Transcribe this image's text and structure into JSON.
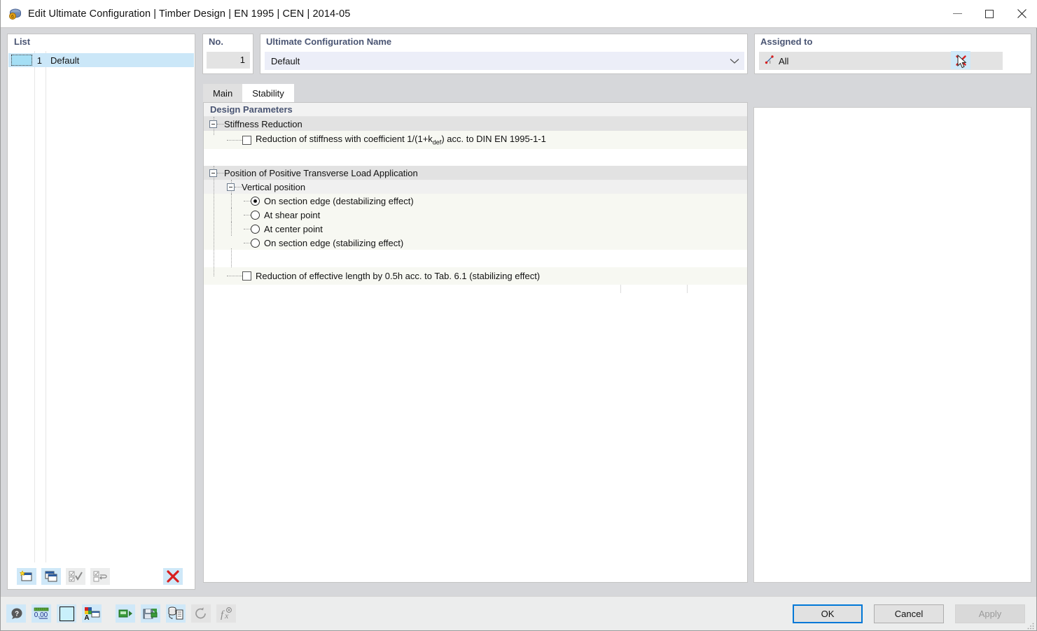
{
  "window": {
    "title": "Edit Ultimate Configuration | Timber Design | EN 1995 | CEN | 2014-05",
    "icon": "app-icon",
    "controls": {
      "minimize": "minimize-icon",
      "maximize": "maximize-icon",
      "close": "close-icon"
    }
  },
  "list_panel": {
    "header": "List",
    "rows": [
      {
        "no": "1",
        "name": "Default",
        "selected": true
      }
    ],
    "toolbar": [
      {
        "name": "new-configuration-button",
        "icon": "new-window-star-icon",
        "enabled": true
      },
      {
        "name": "copy-configuration-button",
        "icon": "copy-window-icon",
        "enabled": true
      },
      {
        "name": "select-all-button",
        "icon": "check-all-icon",
        "enabled": false
      },
      {
        "name": "invert-selection-button",
        "icon": "invert-selection-icon",
        "enabled": false
      },
      {
        "name": "delete-configuration-button",
        "icon": "red-x-icon",
        "enabled": true
      }
    ]
  },
  "no_field": {
    "label": "No.",
    "value": "1"
  },
  "name_field": {
    "label": "Ultimate Configuration Name",
    "value": "Default",
    "dropdown_icon": "chevron-down-icon"
  },
  "assigned_to": {
    "label": "Assigned to",
    "value": "All",
    "value_icon": "member-line-icon",
    "clear_button": "red-x-icon"
  },
  "tabs": [
    {
      "label": "Main",
      "active": false
    },
    {
      "label": "Stability",
      "active": true
    }
  ],
  "design_parameters": {
    "header": "Design Parameters",
    "groups": [
      {
        "title": "Stiffness Reduction",
        "expander": "collapse-icon",
        "items": [
          {
            "type": "checkbox",
            "checked": false,
            "label_pre": "Reduction of stiffness with coefficient 1/(1+k",
            "label_sub": "def",
            "label_post": ") acc. to DIN EN 1995-1-1"
          }
        ]
      },
      {
        "title": "Position of Positive Transverse Load Application",
        "expander": "collapse-icon",
        "subgroup": {
          "title": "Vertical position",
          "expander": "collapse-icon",
          "options": [
            {
              "type": "radio",
              "checked": true,
              "label": "On section edge (destabilizing effect)"
            },
            {
              "type": "radio",
              "checked": false,
              "label": "At shear point"
            },
            {
              "type": "radio",
              "checked": false,
              "label": "At center point"
            },
            {
              "type": "radio",
              "checked": false,
              "label": "On section edge (stabilizing effect)"
            }
          ]
        },
        "items": [
          {
            "type": "checkbox",
            "checked": false,
            "label_pre": "Reduction of effective length by 0.5h acc. to Tab. 6.1 (stabilizing effect)",
            "label_sub": "",
            "label_post": ""
          }
        ]
      }
    ]
  },
  "bottom_toolbar": [
    {
      "name": "help-button",
      "icon": "question-bubble-icon",
      "enabled": true
    },
    {
      "name": "units-decimal-places-button",
      "icon": "units-0-00-icon",
      "enabled": true
    },
    {
      "name": "color-swatch-button",
      "icon": "color-swatch-icon",
      "enabled": true
    },
    {
      "name": "display-properties-button",
      "icon": "font-color-icon",
      "enabled": true
    },
    {
      "name": "import-button",
      "icon": "import-green-icon",
      "enabled": true
    },
    {
      "name": "export-button",
      "icon": "save-green-icon",
      "enabled": true
    },
    {
      "name": "database-report-button",
      "icon": "database-document-icon",
      "enabled": true
    },
    {
      "name": "reset-button",
      "icon": "undo-circle-icon",
      "enabled": false
    },
    {
      "name": "formula-button",
      "icon": "fx-icon",
      "enabled": false
    }
  ],
  "dialog_buttons": [
    {
      "label": "OK",
      "name": "ok-button",
      "primary": true,
      "enabled": true
    },
    {
      "label": "Cancel",
      "name": "cancel-button",
      "primary": false,
      "enabled": true
    },
    {
      "label": "Apply",
      "name": "apply-button",
      "primary": false,
      "enabled": false
    }
  ],
  "colors": {
    "accent_blue": "#0078d7",
    "header_text": "#4a5573",
    "selection": "#cbe7f8",
    "row_item": "#f7f8f2",
    "group_row": "#e2e2e2",
    "red": "#d81f1f"
  }
}
